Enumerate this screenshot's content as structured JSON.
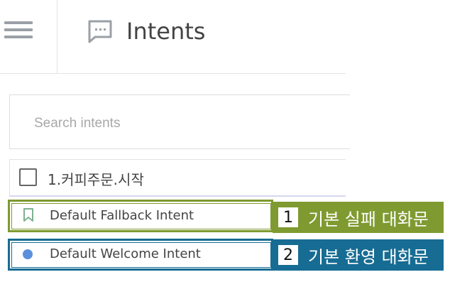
{
  "header": {
    "title": "Intents",
    "menu_icon": "hamburger-menu-icon",
    "title_icon": "chat-bubble-icon"
  },
  "search": {
    "placeholder": "Search intents"
  },
  "intents": {
    "folder": {
      "label": "1.커피주문.시작",
      "icon": "checkbox"
    },
    "items": [
      {
        "label": "Default Fallback Intent",
        "icon": "bookmark-icon"
      },
      {
        "label": "Default Welcome Intent",
        "icon": "dot-icon"
      }
    ]
  },
  "callouts": [
    {
      "number": "1",
      "text": "기본 실패 대화문",
      "color": "#7f9a30"
    },
    {
      "number": "2",
      "text": "기본 환영 대화문",
      "color": "#176c93"
    }
  ]
}
